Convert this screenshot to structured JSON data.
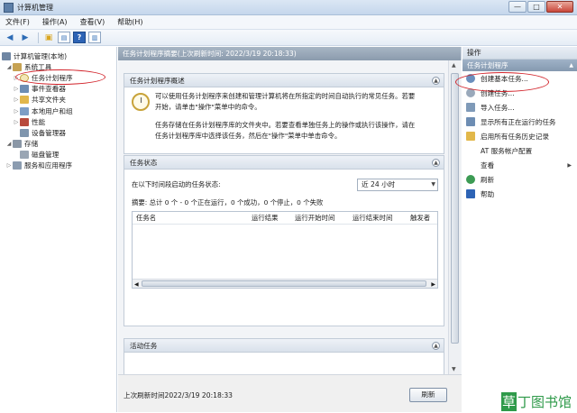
{
  "window": {
    "title": "计算机管理",
    "buttons": {
      "minimize": "—",
      "maximize": "□",
      "close": "✕"
    }
  },
  "menu": [
    "文件(F)",
    "操作(A)",
    "查看(V)",
    "帮助(H)"
  ],
  "tree": {
    "items": [
      {
        "label": "计算机管理(本地)",
        "level": 0,
        "twisty": ""
      },
      {
        "label": "系统工具",
        "level": 1,
        "twisty": "◢"
      },
      {
        "label": "任务计划程序",
        "level": 2,
        "twisty": "▷"
      },
      {
        "label": "事件查看器",
        "level": 2,
        "twisty": "▷"
      },
      {
        "label": "共享文件夹",
        "level": 2,
        "twisty": "▷"
      },
      {
        "label": "本地用户和组",
        "level": 2,
        "twisty": "▷"
      },
      {
        "label": "性能",
        "level": 2,
        "twisty": "▷"
      },
      {
        "label": "设备管理器",
        "level": 2,
        "twisty": ""
      },
      {
        "label": "存储",
        "level": 1,
        "twisty": "◢"
      },
      {
        "label": "磁盘管理",
        "level": 2,
        "twisty": ""
      },
      {
        "label": "服务和应用程序",
        "level": 1,
        "twisty": "▷"
      }
    ]
  },
  "center": {
    "header": "任务计划程序摘要(上次刷新时间: 2022/3/19 20:18:33)",
    "overview": {
      "title": "任务计划程序概述",
      "para1_line1": "可以使用任务计划程序来创建和管理计算机将在所指定的时间自动执行的常见任务。若要",
      "para1_line2": "开始，请单击\"操作\"菜单中的命令。",
      "para2_line1": "任务存储在任务计划程序库的文件夹中。若要查看单独任务上的操作或执行该操作，请在",
      "para2_line2": "任务计划程序库中选择该任务，然后在\"操作\"菜单中单击命令。"
    },
    "status": {
      "title": "任务状态",
      "period_label": "在以下时间段启动的任务状态:",
      "period_value": "近 24 小时",
      "summary": "摘要: 总计 0 个 - 0 个正在运行，0 个成功，0 个停止，0 个失败",
      "columns": [
        "任务名",
        "运行结果",
        "运行开始时间",
        "运行结束时间",
        "触发者"
      ]
    },
    "active": {
      "title": "活动任务"
    },
    "footer": {
      "last_refresh": "上次刷新时间2022/3/19 20:18:33",
      "refresh_button": "刷新"
    }
  },
  "actions": {
    "title": "操作",
    "subheader": "任务计划程序",
    "items": [
      {
        "label": "创建基本任务...",
        "icon": "clock-wand-icon",
        "color": "#6b8fbd"
      },
      {
        "label": "创建任务...",
        "icon": "clock-icon",
        "color": "#9aa9bb"
      },
      {
        "label": "导入任务...",
        "icon": "import-icon",
        "color": "#7f9ab8"
      },
      {
        "label": "显示所有正在运行的任务",
        "icon": "list-icon",
        "color": "#6d8db3"
      },
      {
        "label": "启用所有任务历史记录",
        "icon": "folder-icon",
        "color": "#e2b84a"
      },
      {
        "label": "AT 服务帐户配置",
        "icon": "",
        "color": ""
      },
      {
        "label": "查看",
        "icon": "",
        "color": ""
      },
      {
        "label": "刷新",
        "icon": "refresh-icon",
        "color": "#3c9b54"
      },
      {
        "label": "帮助",
        "icon": "help-icon",
        "color": "#2d63b5"
      }
    ]
  },
  "watermark": {
    "left": "草",
    "right": "丁图书馆"
  }
}
